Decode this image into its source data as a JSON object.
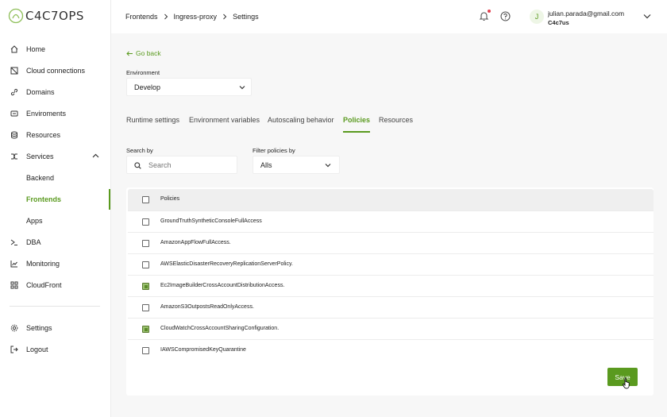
{
  "logo": {
    "text": "C4C7OPS"
  },
  "sidebar": {
    "items": [
      {
        "label": "Home",
        "icon": "home-icon"
      },
      {
        "label": "Cloud connections",
        "icon": "cloud-connections-icon"
      },
      {
        "label": "Domains",
        "icon": "link-icon"
      },
      {
        "label": "Enviroments",
        "icon": "environments-icon"
      },
      {
        "label": "Resources",
        "icon": "database-icon"
      },
      {
        "label": "Services",
        "icon": "services-icon"
      },
      {
        "label": "Backend"
      },
      {
        "label": "Frontends"
      },
      {
        "label": "Apps"
      },
      {
        "label": "DBA",
        "icon": "terminal-icon"
      },
      {
        "label": "Monitoring",
        "icon": "chart-icon"
      },
      {
        "label": "CloudFront",
        "icon": "cloudfront-icon"
      }
    ],
    "bottom": [
      {
        "label": "Settings",
        "icon": "gear-icon"
      },
      {
        "label": "Logout",
        "icon": "logout-icon"
      }
    ]
  },
  "breadcrumb": [
    "Frontends",
    "Ingress-proxy",
    "Settings"
  ],
  "user": {
    "initial": "J",
    "email": "julian.parada@gmail.com",
    "org": "C4c7us"
  },
  "go_back": "Go back",
  "environment": {
    "label": "Environment",
    "value": "Develop"
  },
  "tabs": [
    "Runtime settings",
    "Environment variables",
    "Autoscaling behavior",
    "Policies",
    "Resources"
  ],
  "active_tab": "Policies",
  "search": {
    "label": "Search by",
    "placeholder": "Search"
  },
  "filter": {
    "label": "Filter policies by",
    "value": "Alls"
  },
  "table": {
    "header": "Policies",
    "rows": [
      {
        "name": "GroundTruthSyntheticConsoleFullAccess",
        "checked": false
      },
      {
        "name": "AmazonAppFlowFullAccess.",
        "checked": false
      },
      {
        "name": "AWSElasticDisasterRecoveryReplicationServerPolicy.",
        "checked": false
      },
      {
        "name": "Ec2ImageBuilderCrossAccountDistributionAccess.",
        "checked": true
      },
      {
        "name": "AmazonS3OutpostsReadOnlyAccess.",
        "checked": false
      },
      {
        "name": "CloudWatchCrossAccountSharingConfiguration.",
        "checked": true
      },
      {
        "name": "IAWSCompromisedKeyQuarantine",
        "checked": false
      }
    ]
  },
  "save_label": "Save",
  "colors": {
    "accent": "#5a9a1f",
    "notification": "#e2404f"
  }
}
